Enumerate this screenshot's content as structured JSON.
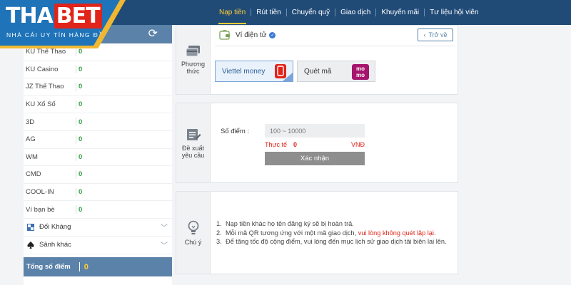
{
  "brand": {
    "name_left": "THA",
    "name_right": "BET",
    "tagline": "NHÀ CÁI UY TÍN HÀNG ĐẦU"
  },
  "nav": [
    "Nạp tiền",
    "Rút tiền",
    "Chuyển quỹ",
    "Giao dịch",
    "Khuyến mãi",
    "Tư liệu hội viên"
  ],
  "sidebar": {
    "items": [
      {
        "label": "KU Thể Thao",
        "value": "0"
      },
      {
        "label": "KU Casino",
        "value": "0"
      },
      {
        "label": "JZ Thể Thao",
        "value": "0"
      },
      {
        "label": "KU Xổ Số",
        "value": "0"
      },
      {
        "label": "3D",
        "value": "0"
      },
      {
        "label": "AG",
        "value": "0"
      },
      {
        "label": "WM",
        "value": "0"
      },
      {
        "label": "CMD",
        "value": "0"
      },
      {
        "label": "COOL-IN",
        "value": "0"
      },
      {
        "label": "Ví bạn bè",
        "value": "0"
      }
    ],
    "expanders": [
      "Đối Kháng",
      "Sảnh khác"
    ],
    "total_label": "Tổng số điểm",
    "total_value": "0"
  },
  "payment": {
    "section_label_1": "Phương",
    "section_label_2": "thức",
    "wallet_title": "Ví điện tử",
    "back_label": "Trở về",
    "methods": [
      "Viettel money",
      "Quét mã"
    ],
    "momo_text_1": "mo",
    "momo_text_2": "mo"
  },
  "request": {
    "section_label_1": "Đề xuất",
    "section_label_2": "yêu cầu",
    "amount_label": "Số điểm :",
    "amount_placeholder": "100 ~ 10000",
    "real_label": "Thực tế",
    "real_value": "0",
    "real_unit": "VNĐ",
    "confirm_label": "Xác nhận"
  },
  "notes": {
    "section_label": "Chú ý",
    "line1": "Nạp tiền khác họ tên đăng ký sẽ bị hoàn trả.",
    "line2_a": "Mỗi mã QR tương ứng với một mã giao dịch,",
    "line2_b": "vui lòng không quét lặp lại.",
    "line3": "Để tăng tốc độ cộng điểm, vui lòng đến mục lịch sử giao dịch tải biên lai lên."
  },
  "colors": {
    "navy": "#214b77",
    "accent": "#ffcc33",
    "panel": "#5b82a9",
    "red": "#e0241a",
    "green": "#2ea043"
  }
}
